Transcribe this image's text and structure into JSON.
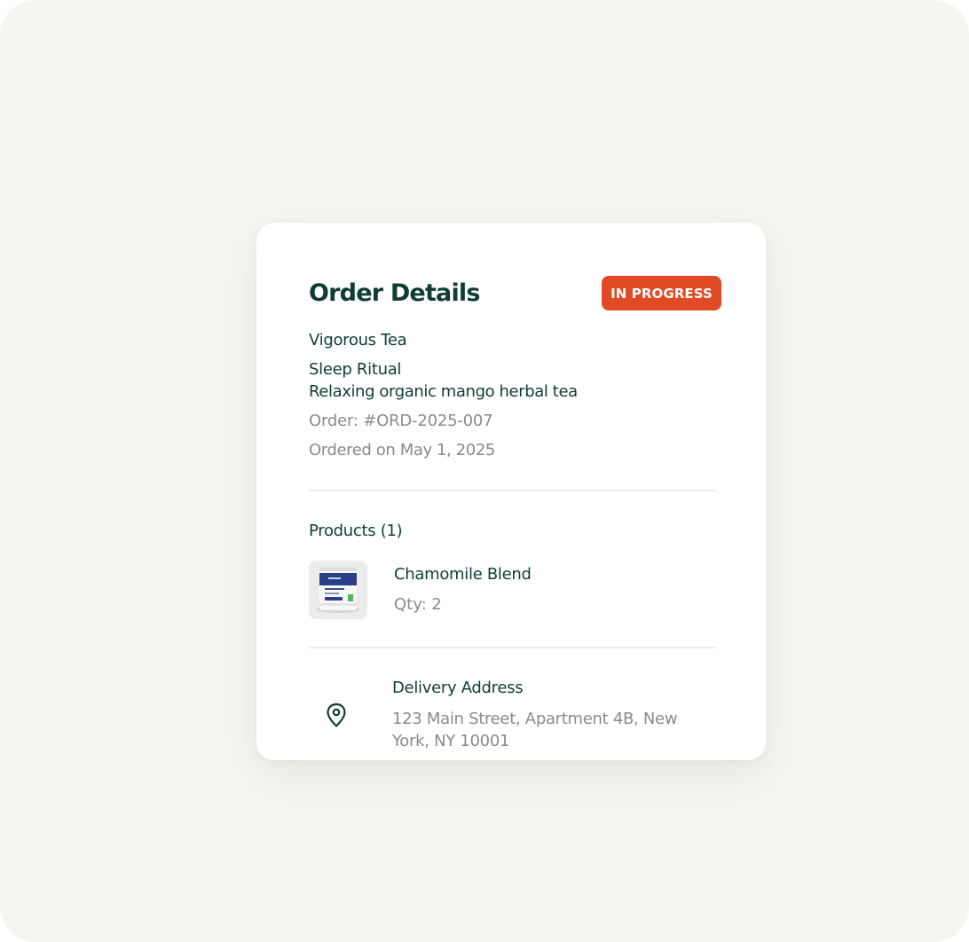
{
  "card": {
    "title": "Order Details",
    "status_badge": "IN PROGRESS",
    "brand": "Vigorous Tea",
    "product_name": "Sleep Ritual",
    "product_description": "Relaxing organic mango herbal tea",
    "order_number": "Order: #ORD-2025-007",
    "ordered_on": "Ordered on May 1, 2025"
  },
  "products": {
    "heading": "Products (1)",
    "items": [
      {
        "name": "Chamomile Blend",
        "qty": "Qty: 2",
        "thumbnail": "tea-tin-image"
      }
    ]
  },
  "delivery": {
    "heading": "Delivery Address",
    "address": "123 Main Street, Apartment 4B, New York, NY 10001",
    "icon": "location-pin-icon"
  },
  "colors": {
    "primary_text": "#0f3d36",
    "secondary_text": "#8a8a86",
    "badge": "#e04a25",
    "background": "#f6f5f0"
  }
}
